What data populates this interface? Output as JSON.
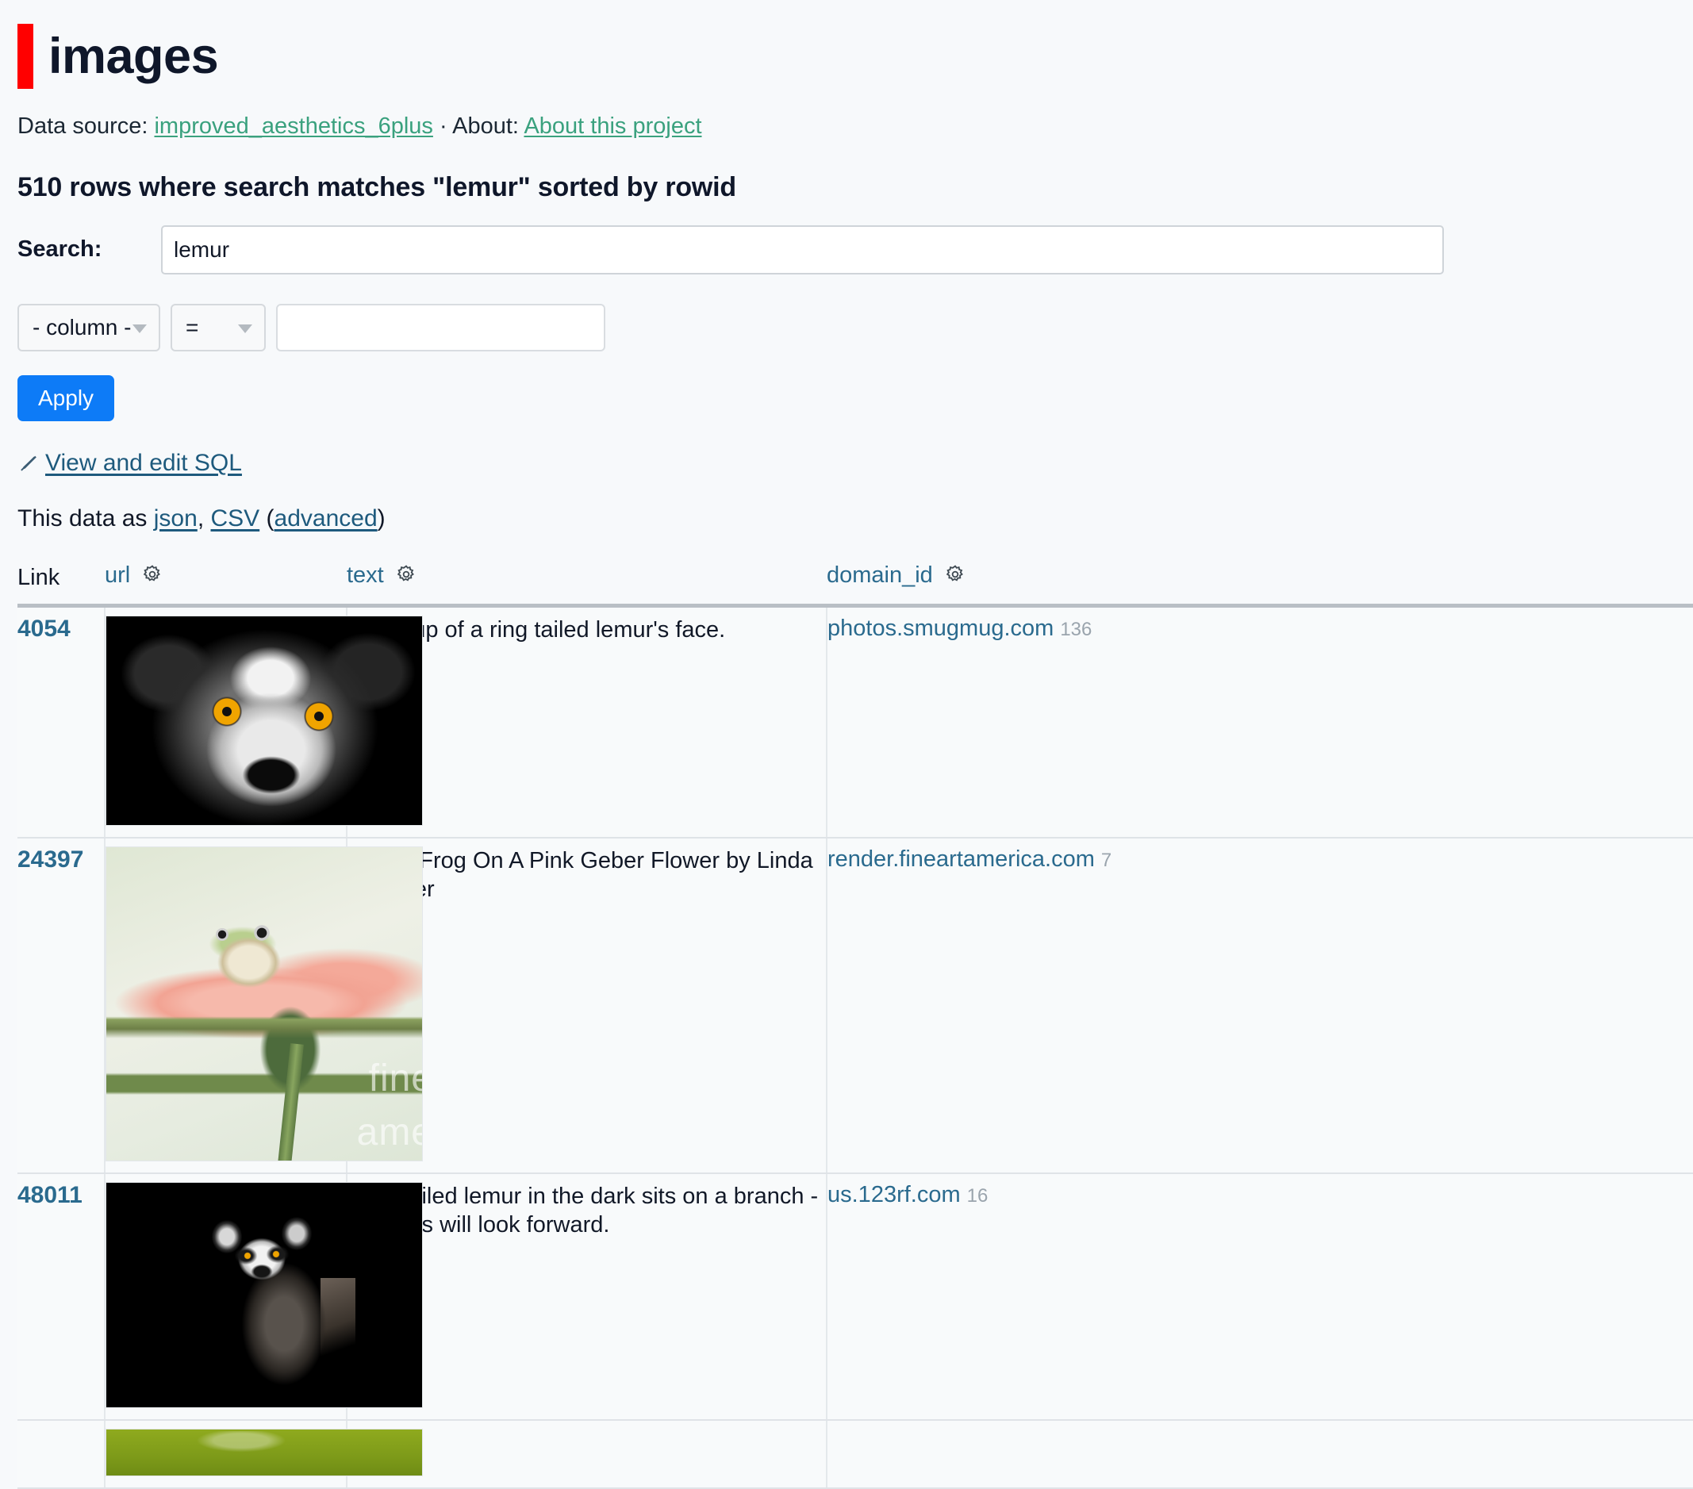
{
  "header": {
    "title": "images",
    "accent_color": "#ff0000"
  },
  "source": {
    "prefix": "Data source:",
    "datasource_label": "improved_aesthetics_6plus",
    "separator": "·",
    "about_prefix": "About:",
    "about_label": "About this project",
    "link_color": "#3aa17e"
  },
  "results": {
    "heading": "510 rows where search matches \"lemur\" sorted by rowid",
    "row_count": 510,
    "search_term": "lemur",
    "sort_by": "rowid"
  },
  "search": {
    "label": "Search:",
    "value": "lemur",
    "placeholder": ""
  },
  "filter": {
    "column_value": "- column -",
    "operator_value": "=",
    "value": "",
    "value_placeholder": "",
    "apply_label": "Apply"
  },
  "sql": {
    "icon": "pencil-icon",
    "link_label": "View and edit SQL"
  },
  "export": {
    "prefix": "This data as",
    "json_label": "json",
    "comma": ",",
    "csv_label": "CSV",
    "open_paren": "(",
    "advanced_label": "advanced",
    "close_paren": ")"
  },
  "table": {
    "columns": [
      {
        "label": "Link",
        "gear": false
      },
      {
        "label": "url",
        "gear": true,
        "gear_icon": "gear-icon"
      },
      {
        "label": "text",
        "gear": true,
        "gear_icon": "gear-icon"
      },
      {
        "label": "domain_id",
        "gear": true,
        "gear_icon": "gear-icon"
      }
    ],
    "rows": [
      {
        "link": "4054",
        "thumb_alt": "close-up black and white lemur face with orange eyes",
        "text": "Close up of a ring tailed lemur's face.",
        "domain": "photos.smugmug.com",
        "domain_id": "136"
      },
      {
        "link": "24397",
        "thumb_alt": "small frog sitting on a pink gerbera flower",
        "text": "Lemur Frog On A Pink Geber Flower by Linda D Lester",
        "domain": "render.fineartamerica.com",
        "domain_id": "7"
      },
      {
        "link": "48011",
        "thumb_alt": "ring-tailed lemur on a branch against a black background",
        "text": "Ring-tailed lemur in the dark sits on a branch - big eyes will look forward.",
        "domain": "us.123rf.com",
        "domain_id": "16"
      },
      {
        "link": "",
        "thumb_alt": "green image partially visible at bottom edge",
        "text": "",
        "domain": "",
        "domain_id": ""
      }
    ]
  }
}
